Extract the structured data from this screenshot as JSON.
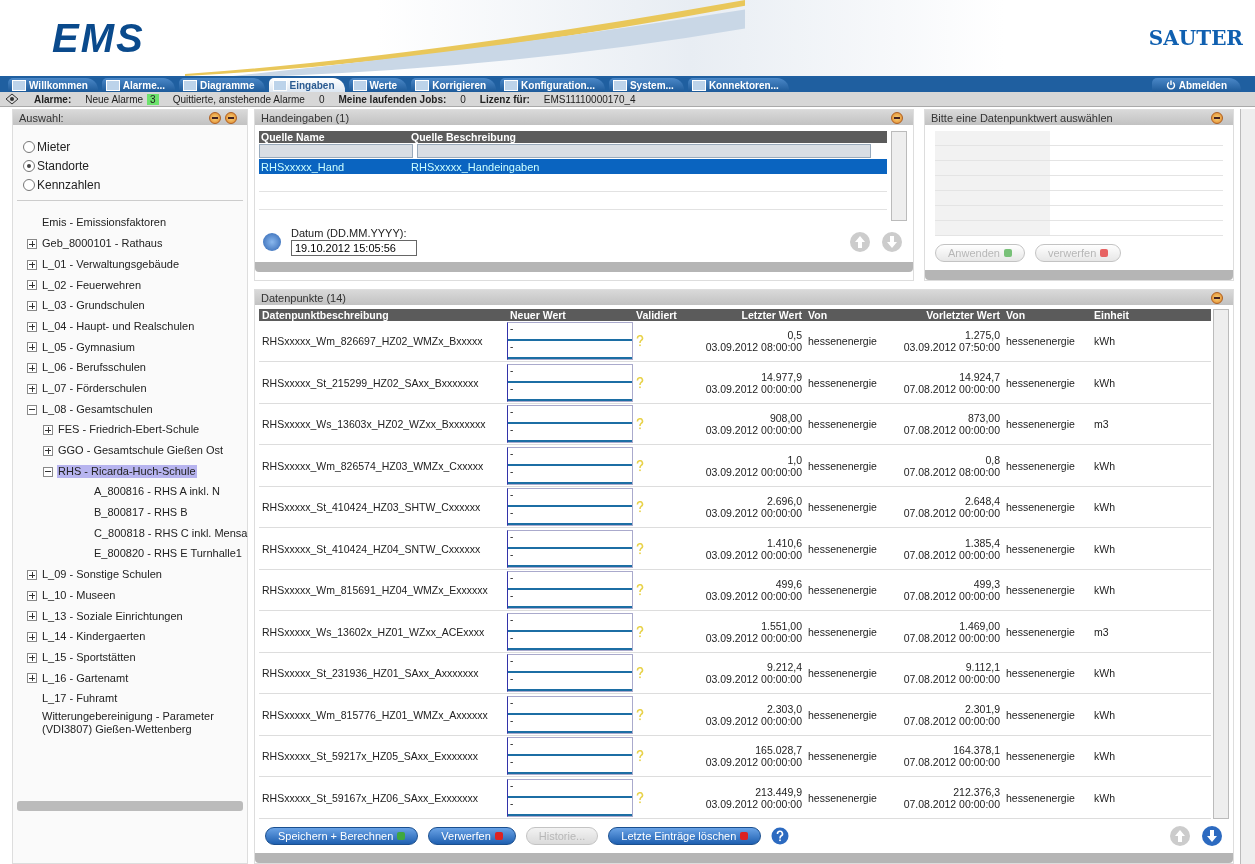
{
  "header": {
    "logo": "EMS",
    "brand": "SAUTER"
  },
  "tabs": [
    {
      "label": "Willkommen",
      "selected": false
    },
    {
      "label": "Alarme...",
      "selected": false
    },
    {
      "label": "Diagramme",
      "selected": false
    },
    {
      "label": "Eingaben",
      "selected": true
    },
    {
      "label": "Werte",
      "selected": false
    },
    {
      "label": "Korrigieren",
      "selected": false
    },
    {
      "label": "Konfiguration...",
      "selected": false
    },
    {
      "label": "System...",
      "selected": false
    },
    {
      "label": "Konnektoren...",
      "selected": false
    }
  ],
  "logout": "Abmelden",
  "alarm_bar": {
    "label": "Alarme:",
    "new_label": "Neue Alarme",
    "new_count": "3",
    "ack_label": "Quittierte, anstehende Alarme",
    "ack_count": "0",
    "jobs_label": "Meine laufenden Jobs:",
    "jobs_count": "0",
    "license_label": "Lizenz für:",
    "license": "EMS11110000170_4"
  },
  "sidebar": {
    "title": "Auswahl:",
    "radios": [
      {
        "label": "Mieter",
        "selected": false
      },
      {
        "label": "Standorte",
        "selected": true
      },
      {
        "label": "Kennzahlen",
        "selected": false
      }
    ],
    "tree": [
      {
        "label": "Emis - Emissionsfaktoren",
        "kind": "leaf",
        "selected": false
      },
      {
        "label": "Geb_8000101 - Rathaus",
        "kind": "folder",
        "expanded": false,
        "selected": false
      },
      {
        "label": "L_01 - Verwaltungsgebäude",
        "kind": "folder",
        "expanded": false,
        "selected": false
      },
      {
        "label": "L_02 - Feuerwehren",
        "kind": "folder",
        "expanded": false,
        "selected": false
      },
      {
        "label": "L_03 - Grundschulen",
        "kind": "folder",
        "expanded": false,
        "selected": false
      },
      {
        "label": "L_04 - Haupt- und Realschulen",
        "kind": "folder",
        "expanded": false,
        "selected": false
      },
      {
        "label": "L_05 - Gymnasium",
        "kind": "folder",
        "expanded": false,
        "selected": false
      },
      {
        "label": "L_06 - Berufsschulen",
        "kind": "folder",
        "expanded": false,
        "selected": false
      },
      {
        "label": "L_07 - Förderschulen",
        "kind": "folder",
        "expanded": false,
        "selected": false
      },
      {
        "label": "L_08 - Gesamtschulen",
        "kind": "folder",
        "expanded": true,
        "selected": false,
        "children": [
          {
            "label": "FES - Friedrich-Ebert-Schule",
            "kind": "folder",
            "expanded": false,
            "selected": false
          },
          {
            "label": "GGO - Gesamtschule Gießen Ost",
            "kind": "folder",
            "expanded": false,
            "selected": false
          },
          {
            "label": "RHS - Ricarda-Huch-Schule",
            "kind": "folder",
            "expanded": true,
            "selected": true,
            "children": [
              {
                "label": "A_800816 - RHS A inkl. N",
                "kind": "leaf",
                "selected": false
              },
              {
                "label": "B_800817 - RHS B",
                "kind": "leaf",
                "selected": false
              },
              {
                "label": "C_800818 - RHS C inkl. Mensa",
                "kind": "leaf",
                "selected": false
              },
              {
                "label": "E_800820 - RHS E Turnhalle1",
                "kind": "leaf",
                "selected": false
              }
            ]
          }
        ]
      },
      {
        "label": "L_09 - Sonstige Schulen",
        "kind": "folder",
        "expanded": false,
        "selected": false
      },
      {
        "label": "L_10 - Museen",
        "kind": "folder",
        "expanded": false,
        "selected": false
      },
      {
        "label": "L_13 - Soziale Einrichtungen",
        "kind": "folder",
        "expanded": false,
        "selected": false
      },
      {
        "label": "L_14 - Kindergaerten",
        "kind": "folder",
        "expanded": false,
        "selected": false
      },
      {
        "label": "L_15 - Sportstätten",
        "kind": "folder",
        "expanded": false,
        "selected": false
      },
      {
        "label": "L_16 - Gartenamt",
        "kind": "folder",
        "expanded": false,
        "selected": false
      },
      {
        "label": "L_17 - Fuhramt",
        "kind": "leaf",
        "selected": false
      },
      {
        "label": "Witterungebereinigung - Parameter (VDI3807) Gießen-Wettenberg",
        "kind": "leaf",
        "selected": false
      }
    ]
  },
  "manual": {
    "title": "Handeingaben (1)",
    "columns": [
      "Quelle Name",
      "Quelle Beschreibung"
    ],
    "rows": [
      {
        "name": "RHSxxxxx_Hand",
        "description": "RHSxxxxx_Handeingaben",
        "selected": true
      }
    ],
    "date_label": "Datum (DD.MM.YYYY):",
    "date_value": "19.10.2012 15:05:56"
  },
  "detail": {
    "title": "Bitte eine Datenpunktwert auswählen",
    "buttons": [
      {
        "label": "Anwenden",
        "kind": "apply",
        "disabled": true
      },
      {
        "label": "verwerfen",
        "kind": "discard",
        "disabled": true
      }
    ]
  },
  "datapoints": {
    "title": "Datenpunkte (14)",
    "columns": [
      "Datenpunktbeschreibung",
      "Neuer Wert",
      "Validiert",
      "Letzter Wert",
      "Von",
      "Vorletzter Wert",
      "Von",
      "Einheit"
    ],
    "rows": [
      {
        "description": "RHSxxxxx_Wm_826697_HZ02_WMZx_Bxxxxx",
        "new": [
          "-",
          "-"
        ],
        "last": "0,5",
        "last_date": "03.09.2012 08:00:00",
        "by": "hessenenergie",
        "prev": "1.275,0",
        "prev_date": "03.09.2012 07:50:00",
        "prev_by": "hessenenergie",
        "unit": "kWh"
      },
      {
        "description": "RHSxxxxx_St_215299_HZ02_SAxx_Bxxxxxxx",
        "new": [
          "-",
          "-"
        ],
        "last": "14.977,9",
        "last_date": "03.09.2012 00:00:00",
        "by": "hessenenergie",
        "prev": "14.924,7",
        "prev_date": "07.08.2012 00:00:00",
        "prev_by": "hessenenergie",
        "unit": "kWh"
      },
      {
        "description": "RHSxxxxx_Ws_13603x_HZ02_WZxx_Bxxxxxxx",
        "new": [
          "-",
          "-"
        ],
        "last": "908,00",
        "last_date": "03.09.2012 00:00:00",
        "by": "hessenenergie",
        "prev": "873,00",
        "prev_date": "07.08.2012 00:00:00",
        "prev_by": "hessenenergie",
        "unit": "m3"
      },
      {
        "description": "RHSxxxxx_Wm_826574_HZ03_WMZx_Cxxxxx",
        "new": [
          "-",
          "-"
        ],
        "last": "1,0",
        "last_date": "03.09.2012 00:00:00",
        "by": "hessenenergie",
        "prev": "0,8",
        "prev_date": "07.08.2012 08:00:00",
        "prev_by": "hessenenergie",
        "unit": "kWh"
      },
      {
        "description": "RHSxxxxx_St_410424_HZ03_SHTW_Cxxxxxx",
        "new": [
          "-",
          "-"
        ],
        "last": "2.696,0",
        "last_date": "03.09.2012 00:00:00",
        "by": "hessenenergie",
        "prev": "2.648,4",
        "prev_date": "07.08.2012 00:00:00",
        "prev_by": "hessenenergie",
        "unit": "kWh"
      },
      {
        "description": "RHSxxxxx_St_410424_HZ04_SNTW_Cxxxxxx",
        "new": [
          "-",
          "-"
        ],
        "last": "1.410,6",
        "last_date": "03.09.2012 00:00:00",
        "by": "hessenenergie",
        "prev": "1.385,4",
        "prev_date": "07.08.2012 00:00:00",
        "prev_by": "hessenenergie",
        "unit": "kWh"
      },
      {
        "description": "RHSxxxxx_Wm_815691_HZ04_WMZx_Exxxxxx",
        "new": [
          "-",
          "-"
        ],
        "last": "499,6",
        "last_date": "03.09.2012 00:00:00",
        "by": "hessenenergie",
        "prev": "499,3",
        "prev_date": "07.08.2012 00:00:00",
        "prev_by": "hessenenergie",
        "unit": "kWh"
      },
      {
        "description": "RHSxxxxx_Ws_13602x_HZ01_WZxx_ACExxxx",
        "new": [
          "-",
          "-"
        ],
        "last": "1.551,00",
        "last_date": "03.09.2012 00:00:00",
        "by": "hessenenergie",
        "prev": "1.469,00",
        "prev_date": "07.08.2012 00:00:00",
        "prev_by": "hessenenergie",
        "unit": "m3"
      },
      {
        "description": "RHSxxxxx_St_231936_HZ01_SAxx_Axxxxxxx",
        "new": [
          "-",
          "-"
        ],
        "last": "9.212,4",
        "last_date": "03.09.2012 00:00:00",
        "by": "hessenenergie",
        "prev": "9.112,1",
        "prev_date": "07.08.2012 00:00:00",
        "prev_by": "hessenenergie",
        "unit": "kWh"
      },
      {
        "description": "RHSxxxxx_Wm_815776_HZ01_WMZx_Axxxxxx",
        "new": [
          "-",
          "-"
        ],
        "last": "2.303,0",
        "last_date": "03.09.2012 00:00:00",
        "by": "hessenenergie",
        "prev": "2.301,9",
        "prev_date": "07.08.2012 00:00:00",
        "prev_by": "hessenenergie",
        "unit": "kWh"
      },
      {
        "description": "RHSxxxxx_St_59217x_HZ05_SAxx_Exxxxxxx",
        "new": [
          "-",
          "-"
        ],
        "last": "165.028,7",
        "last_date": "03.09.2012 00:00:00",
        "by": "hessenenergie",
        "prev": "164.378,1",
        "prev_date": "07.08.2012 00:00:00",
        "prev_by": "hessenenergie",
        "unit": "kWh"
      },
      {
        "description": "RHSxxxxx_St_59167x_HZ06_SAxx_Exxxxxxx",
        "new": [
          "-",
          "-"
        ],
        "last": "213.449,9",
        "last_date": "03.09.2012 00:00:00",
        "by": "hessenenergie",
        "prev": "212.376,3",
        "prev_date": "07.08.2012 00:00:00",
        "prev_by": "hessenenergie",
        "unit": "kWh"
      }
    ],
    "buttons": [
      {
        "label": "Speichern + Berechnen",
        "kind": "save",
        "disabled": false
      },
      {
        "label": "Verwerfen",
        "kind": "discard",
        "disabled": false
      },
      {
        "label": "Historie...",
        "kind": "plain",
        "disabled": true
      },
      {
        "label": "Letzte Einträge löschen",
        "kind": "discard",
        "disabled": false
      }
    ]
  }
}
